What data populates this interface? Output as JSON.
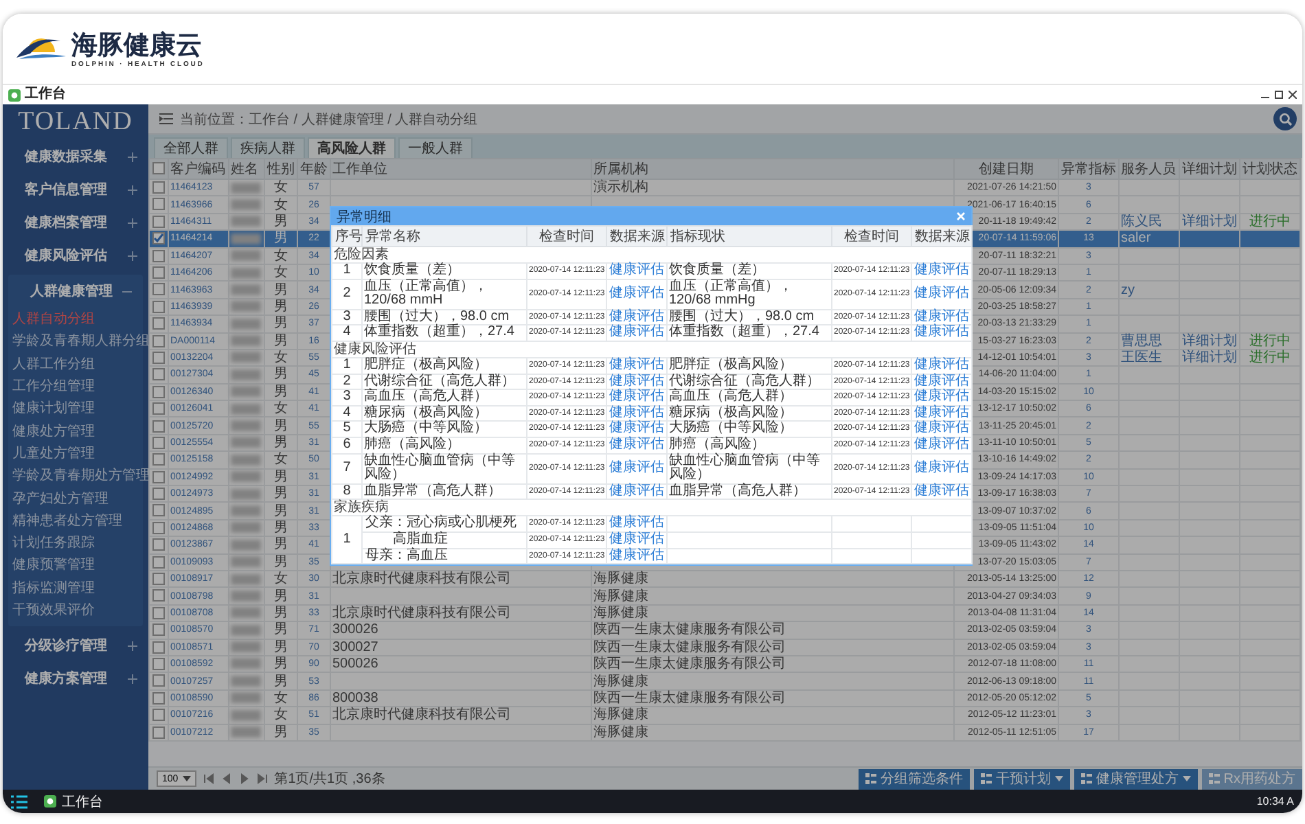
{
  "header": {
    "brand": "海豚健康云",
    "tagline": "DOLPHIN · HEALTH CLOUD"
  },
  "window": {
    "title": "工作台"
  },
  "sidebar": {
    "brand": "TOLAND",
    "items": [
      {
        "label": "健康数据采集",
        "expanded": false
      },
      {
        "label": "客户信息管理",
        "expanded": false
      },
      {
        "label": "健康档案管理",
        "expanded": false
      },
      {
        "label": "健康风险评估",
        "expanded": false
      },
      {
        "label": "人群健康管理",
        "expanded": true,
        "children": [
          {
            "label": "人群自动分组",
            "selected": true
          },
          {
            "label": "学龄及青春期人群分组",
            "selected": false
          },
          {
            "label": "人群工作分组",
            "selected": false
          },
          {
            "label": "工作分组管理",
            "selected": false
          },
          {
            "label": "健康计划管理",
            "selected": false
          },
          {
            "label": "健康处方管理",
            "selected": false
          },
          {
            "label": "儿童处方管理",
            "selected": false
          },
          {
            "label": "学龄及青春期处方管理",
            "selected": false
          },
          {
            "label": "孕产妇处方管理",
            "selected": false
          },
          {
            "label": "精神患者处方管理",
            "selected": false
          },
          {
            "label": "计划任务跟踪",
            "selected": false
          },
          {
            "label": "健康预警管理",
            "selected": false
          },
          {
            "label": "指标监测管理",
            "selected": false
          },
          {
            "label": "干预效果评价",
            "selected": false
          }
        ]
      },
      {
        "label": "分级诊疗管理",
        "expanded": false
      },
      {
        "label": "健康方案管理",
        "expanded": false
      }
    ]
  },
  "breadcrumb": "当前位置：工作台 / 人群健康管理 / 人群自动分组",
  "tabs": [
    {
      "label": "全部人群",
      "selected": false
    },
    {
      "label": "疾病人群",
      "selected": false
    },
    {
      "label": "高风险人群",
      "selected": true
    },
    {
      "label": "一般人群",
      "selected": false
    }
  ],
  "table": {
    "select_all_checked": false,
    "columns": [
      "客户编码",
      "姓名",
      "性别",
      "年龄",
      "工作单位",
      "所属机构",
      "创建日期",
      "异常指标",
      "服务人员",
      "详细计划",
      "计划状态"
    ],
    "rows": [
      {
        "code": "11464123",
        "sex": "女",
        "age": "57",
        "org": "演示机构",
        "created": "2021-07-26 14:21:50",
        "abnormal": "3",
        "checked": false,
        "selected": false
      },
      {
        "code": "11463966",
        "sex": "女",
        "age": "26",
        "created": "2021-06-17 16:40:15",
        "abnormal": "6",
        "checked": false,
        "selected": false
      },
      {
        "code": "11464311",
        "sex": "男",
        "age": "34",
        "created": "20-11-18 19:49:42",
        "abnormal": "2",
        "staff": "陈义民",
        "plan": "详细计划",
        "status": "进行中",
        "checked": false,
        "selected": false
      },
      {
        "code": "11464214",
        "sex": "男",
        "age": "22",
        "created": "20-07-14 11:59:06",
        "abnormal": "13",
        "staff": "saler",
        "checked": true,
        "selected": true
      },
      {
        "code": "11464207",
        "sex": "女",
        "age": "34",
        "created": "20-07-11 18:32:21",
        "abnormal": "3",
        "checked": false,
        "selected": false
      },
      {
        "code": "11464206",
        "sex": "女",
        "age": "10",
        "created": "20-07-11 18:29:13",
        "abnormal": "1",
        "checked": false,
        "selected": false
      },
      {
        "code": "11463963",
        "sex": "男",
        "age": "34",
        "created": "20-05-06 12:09:34",
        "abnormal": "2",
        "staff": "zy",
        "checked": false,
        "selected": false
      },
      {
        "code": "11463939",
        "sex": "男",
        "age": "26",
        "created": "20-03-25 18:58:27",
        "abnormal": "1",
        "checked": false,
        "selected": false
      },
      {
        "code": "11463934",
        "sex": "男",
        "age": "37",
        "created": "20-03-13 21:33:29",
        "abnormal": "1",
        "checked": false,
        "selected": false
      },
      {
        "code": "DA000114",
        "sex": "男",
        "age": "16",
        "created": "15-03-27 16:23:03",
        "abnormal": "2",
        "staff": "曹思思",
        "plan": "详细计划",
        "status": "进行中",
        "checked": false,
        "selected": false
      },
      {
        "code": "00132204",
        "sex": "女",
        "age": "55",
        "created": "14-12-01 10:54:01",
        "abnormal": "3",
        "staff": "王医生",
        "plan": "详细计划",
        "status": "进行中",
        "checked": false,
        "selected": false
      },
      {
        "code": "00127304",
        "sex": "男",
        "age": "45",
        "created": "14-06-20 11:04:00",
        "abnormal": "1",
        "checked": false,
        "selected": false
      },
      {
        "code": "00126340",
        "sex": "男",
        "age": "41",
        "created": "14-03-20 15:15:02",
        "abnormal": "10",
        "checked": false,
        "selected": false
      },
      {
        "code": "00126041",
        "sex": "女",
        "age": "41",
        "created": "13-12-17 10:50:02",
        "abnormal": "6",
        "checked": false,
        "selected": false
      },
      {
        "code": "00125720",
        "sex": "男",
        "age": "55",
        "created": "13-11-25 20:45:01",
        "abnormal": "2",
        "checked": false,
        "selected": false
      },
      {
        "code": "00125554",
        "sex": "男",
        "age": "31",
        "created": "13-11-10 10:50:01",
        "abnormal": "5",
        "checked": false,
        "selected": false
      },
      {
        "code": "00125158",
        "sex": "女",
        "age": "50",
        "created": "13-10-16 14:49:02",
        "abnormal": "2",
        "checked": false,
        "selected": false
      },
      {
        "code": "00124992",
        "sex": "男",
        "age": "31",
        "created": "13-09-24 14:17:03",
        "abnormal": "10",
        "checked": false,
        "selected": false
      },
      {
        "code": "00124973",
        "sex": "男",
        "age": "31",
        "created": "13-09-17 16:38:03",
        "abnormal": "7",
        "checked": false,
        "selected": false
      },
      {
        "code": "00124895",
        "sex": "男",
        "age": "31",
        "created": "13-09-07 10:37:02",
        "abnormal": "6",
        "checked": false,
        "selected": false
      },
      {
        "code": "00124868",
        "sex": "男",
        "age": "33",
        "created": "13-09-05 11:51:04",
        "abnormal": "10",
        "checked": false,
        "selected": false
      },
      {
        "code": "00123867",
        "sex": "男",
        "age": "41",
        "created": "13-09-05 11:43:02",
        "abnormal": "14",
        "checked": false,
        "selected": false
      },
      {
        "code": "00109093",
        "sex": "男",
        "age": "35",
        "created": "13-07-20 15:03:05",
        "abnormal": "7",
        "checked": false,
        "selected": false
      },
      {
        "code": "00108917",
        "sex": "女",
        "age": "30",
        "work_unit": "北京康时代健康科技有限公司",
        "org": "海豚健康",
        "created": "2013-05-14 13:25:00",
        "abnormal": "12",
        "checked": false,
        "selected": false
      },
      {
        "code": "00108798",
        "sex": "男",
        "age": "31",
        "org": "海豚健康",
        "created": "2013-04-27 09:34:03",
        "abnormal": "9",
        "checked": false,
        "selected": false
      },
      {
        "code": "00108708",
        "sex": "男",
        "age": "33",
        "work_unit": "北京康时代健康科技有限公司",
        "org": "海豚健康",
        "created": "2013-04-08 11:31:04",
        "abnormal": "14",
        "checked": false,
        "selected": false
      },
      {
        "code": "00108570",
        "sex": "男",
        "age": "71",
        "work_unit": "300026",
        "org": "陕西一生康太健康服务有限公司",
        "created": "2013-02-05 03:59:04",
        "abnormal": "3",
        "checked": false,
        "selected": false
      },
      {
        "code": "00108571",
        "sex": "男",
        "age": "70",
        "work_unit": "300027",
        "org": "陕西一生康太健康服务有限公司",
        "created": "2013-02-05 03:59:04",
        "abnormal": "3",
        "checked": false,
        "selected": false
      },
      {
        "code": "00108592",
        "sex": "男",
        "age": "90",
        "work_unit": "500026",
        "org": "陕西一生康太健康服务有限公司",
        "created": "2012-07-18 11:08:00",
        "abnormal": "11",
        "checked": false,
        "selected": false
      },
      {
        "code": "00107257",
        "sex": "男",
        "age": "53",
        "org": "海豚健康",
        "created": "2012-06-13 09:18:00",
        "abnormal": "11",
        "checked": false,
        "selected": false
      },
      {
        "code": "00108590",
        "sex": "女",
        "age": "86",
        "work_unit": "800038",
        "org": "陕西一生康太健康服务有限公司",
        "created": "2012-05-20 05:12:02",
        "abnormal": "5",
        "checked": false,
        "selected": false
      },
      {
        "code": "00107216",
        "sex": "女",
        "age": "51",
        "work_unit": "北京康时代健康科技有限公司",
        "org": "海豚健康",
        "created": "2012-05-12 11:23:01",
        "abnormal": "3",
        "checked": false,
        "selected": false
      },
      {
        "code": "00107212",
        "sex": "男",
        "age": "35",
        "org": "海豚健康",
        "created": "2012-05-11 12:51:05",
        "abnormal": "17",
        "checked": false,
        "selected": false
      }
    ]
  },
  "pager": {
    "page_size": "100",
    "info": "第1页/共1页 ,36条"
  },
  "actions": [
    {
      "label": "分组筛选条件",
      "has_menu": false,
      "disabled": false
    },
    {
      "label": "干预计划",
      "has_menu": true,
      "disabled": false
    },
    {
      "label": "健康管理处方",
      "has_menu": true,
      "disabled": false
    },
    {
      "label": "Rx用药处方",
      "has_menu": false,
      "disabled": true
    }
  ],
  "dialog": {
    "title": "异常明细",
    "columns": [
      "序号",
      "异常名称",
      "检查时间",
      "数据来源",
      "指标现状",
      "检查时间",
      "数据来源"
    ],
    "sections": [
      {
        "kind": "list",
        "title": "危险因素",
        "rows": [
          {
            "no": "1",
            "name": "饮食质量（差）",
            "time": "2020-07-14 12:11:23",
            "source": "健康评估",
            "status": "饮食质量（差）",
            "status_time": "2020-07-14 12:11:23",
            "status_source": "健康评估"
          },
          {
            "no": "2",
            "name": "血压（正常高值），120/68 mmH",
            "time": "2020-07-14 12:11:23",
            "source": "健康评估",
            "status": "血压（正常高值），120/68 mmHg",
            "status_time": "2020-07-14 12:11:23",
            "status_source": "健康评估"
          },
          {
            "no": "3",
            "name": "腰围（过大），98.0 cm",
            "time": "2020-07-14 12:11:23",
            "source": "健康评估",
            "status": "腰围（过大），98.0 cm",
            "status_time": "2020-07-14 12:11:23",
            "status_source": "健康评估"
          },
          {
            "no": "4",
            "name": "体重指数（超重），27.4",
            "time": "2020-07-14 12:11:23",
            "source": "健康评估",
            "status": "体重指数（超重），27.4",
            "status_time": "2020-07-14 12:11:23",
            "status_source": "健康评估"
          }
        ]
      },
      {
        "kind": "list",
        "title": "健康风险评估",
        "rows": [
          {
            "no": "1",
            "name": "肥胖症（极高风险）",
            "time": "2020-07-14 12:11:23",
            "source": "健康评估",
            "status": "肥胖症（极高风险）",
            "status_time": "2020-07-14 12:11:23",
            "status_source": "健康评估"
          },
          {
            "no": "2",
            "name": "代谢综合征（高危人群）",
            "time": "2020-07-14 12:11:23",
            "source": "健康评估",
            "status": "代谢综合征（高危人群）",
            "status_time": "2020-07-14 12:11:23",
            "status_source": "健康评估"
          },
          {
            "no": "3",
            "name": "高血压（高危人群）",
            "time": "2020-07-14 12:11:23",
            "source": "健康评估",
            "status": "高血压（高危人群）",
            "status_time": "2020-07-14 12:11:23",
            "status_source": "健康评估"
          },
          {
            "no": "4",
            "name": "糖尿病（极高风险）",
            "time": "2020-07-14 12:11:23",
            "source": "健康评估",
            "status": "糖尿病（极高风险）",
            "status_time": "2020-07-14 12:11:23",
            "status_source": "健康评估"
          },
          {
            "no": "5",
            "name": "大肠癌（中等风险）",
            "time": "2020-07-14 12:11:23",
            "source": "健康评估",
            "status": "大肠癌（中等风险）",
            "status_time": "2020-07-14 12:11:23",
            "status_source": "健康评估"
          },
          {
            "no": "6",
            "name": "肺癌（高风险）",
            "time": "2020-07-14 12:11:23",
            "source": "健康评估",
            "status": "肺癌（高风险）",
            "status_time": "2020-07-14 12:11:23",
            "status_source": "健康评估"
          },
          {
            "no": "7",
            "name": "缺血性心脑血管病（中等风险）",
            "time": "2020-07-14 12:11:23",
            "source": "健康评估",
            "status": "缺血性心脑血管病（中等风险）",
            "status_time": "2020-07-14 12:11:23",
            "status_source": "健康评估"
          },
          {
            "no": "8",
            "name": "血脂异常（高危人群）",
            "time": "2020-07-14 12:11:23",
            "source": "健康评估",
            "status": "血脂异常（高危人群）",
            "status_time": "2020-07-14 12:11:23",
            "status_source": "健康评估"
          }
        ]
      },
      {
        "kind": "grouped",
        "title": "家族疾病",
        "groups": [
          {
            "no": "1",
            "items": [
              {
                "kind": "entry",
                "name": "父亲：冠心病或心肌梗死",
                "time": "2020-07-14 12:11:23",
                "source": "健康评估"
              },
              {
                "kind": "continuation",
                "name": "高脂血症",
                "time": "2020-07-14 12:11:23",
                "source": "健康评估"
              },
              {
                "kind": "entry",
                "name": "母亲：高血压",
                "time": "2020-07-14 12:11:23",
                "source": "健康评估"
              }
            ]
          }
        ]
      }
    ]
  },
  "taskbar": {
    "app": "工作台",
    "time": "10:34 A"
  }
}
